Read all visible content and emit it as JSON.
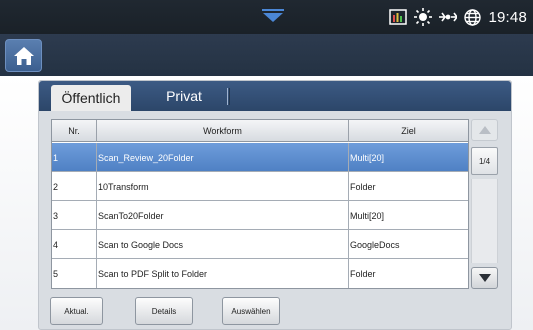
{
  "status_bar": {
    "clock": "19:48",
    "icons": [
      "notification-pull-icon",
      "data-usage-icon",
      "brightness-icon",
      "sync-icon",
      "globe-icon"
    ]
  },
  "app_bar": {
    "home_icon": "home-icon"
  },
  "tabs": [
    {
      "label": "Öffentlich",
      "active": true
    },
    {
      "label": "Privat",
      "active": false
    }
  ],
  "table": {
    "headers": {
      "nr": "Nr.",
      "workform": "Workform",
      "ziel": "Ziel"
    },
    "rows": [
      {
        "nr": "1",
        "workform": "Scan_Review_20Folder",
        "ziel": "Multi[20]",
        "selected": true
      },
      {
        "nr": "2",
        "workform": "10Transform",
        "ziel": "Folder",
        "selected": false
      },
      {
        "nr": "3",
        "workform": "ScanTo20Folder",
        "ziel": "Multi[20]",
        "selected": false
      },
      {
        "nr": "4",
        "workform": "Scan to Google Docs",
        "ziel": "GoogleDocs",
        "selected": false
      },
      {
        "nr": "5",
        "workform": "Scan to PDF Split to Folder",
        "ziel": "Folder",
        "selected": false
      }
    ]
  },
  "pagination": {
    "indicator": "1/4"
  },
  "buttons": {
    "aktual": "Aktual.",
    "details": "Details",
    "auswaehlen": "Auswählen"
  },
  "colors": {
    "selected_row": "#5a8bd0",
    "tab_bar": "#34507a",
    "status_bar": "#1e252d"
  }
}
